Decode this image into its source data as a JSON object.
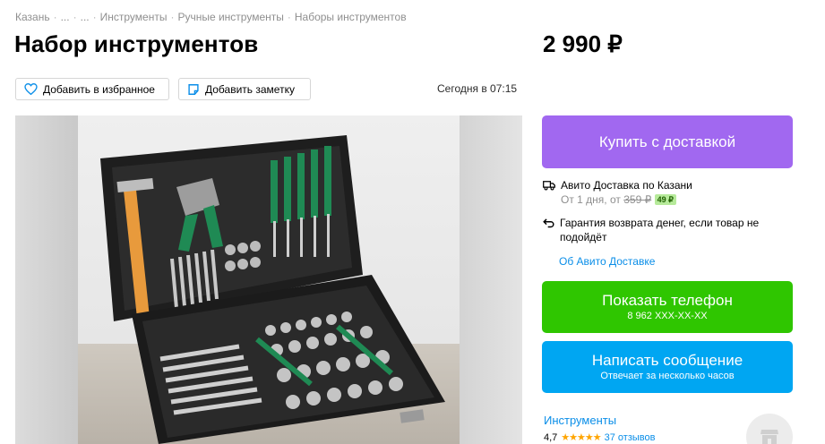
{
  "breadcrumbs": [
    "Казань",
    "...",
    "...",
    "Инструменты",
    "Ручные инструменты",
    "Наборы инструментов"
  ],
  "breadcrumb_separator": "·",
  "title": "Набор инструментов",
  "price": "2 990 ₽",
  "actions": {
    "favorite_label": "Добавить в избранное",
    "note_label": "Добавить заметку"
  },
  "date": "Сегодня в 07:15",
  "buy_button": "Купить с доставкой",
  "delivery": {
    "title": "Авито Доставка по Казани",
    "sub_prefix": "От 1 дня, от ",
    "old_price": "359 ₽",
    "new_price": "49 ₽",
    "guarantee": "Гарантия возврата денег, если товар не подойдёт",
    "about_link": "Об Авито Доставке"
  },
  "phone_button": {
    "label": "Показать телефон",
    "number": "8 962 XXX-XX-XX"
  },
  "message_button": {
    "label": "Написать сообщение",
    "sub": "Отвечает за несколько часов"
  },
  "seller": {
    "name": "Инструменты",
    "rating": "4,7",
    "stars": "★★★★★",
    "reviews": "37 отзывов"
  },
  "icons": [
    "heart-icon",
    "note-icon",
    "truck-icon",
    "return-arrow-icon",
    "shop-icon"
  ],
  "colors": {
    "buy": "#a168f0",
    "phone": "#2fc600",
    "message": "#00a6f2",
    "link": "#0a8ee8",
    "star": "#ffa500"
  }
}
